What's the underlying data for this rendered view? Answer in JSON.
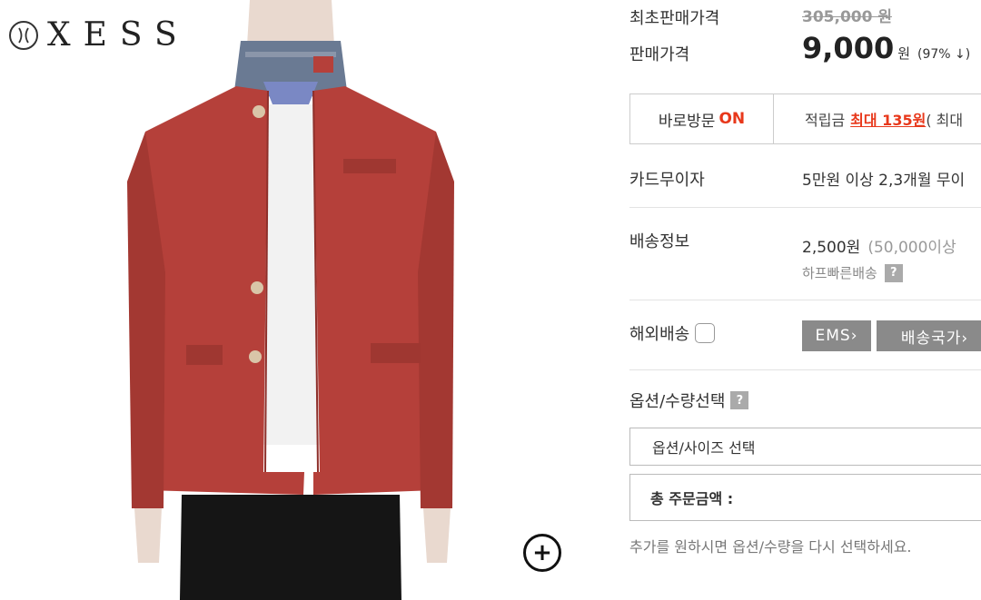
{
  "brand": {
    "name": "XESS",
    "logo": "xess-emblem-icon"
  },
  "zoom": {
    "icon": "zoom-plus-icon"
  },
  "price": {
    "original_label": "최초판매가격",
    "original_value": "305,000 원",
    "sale_label": "판매가격",
    "sale_value": "9,000",
    "sale_unit": "원",
    "discount": "(97% ↓)"
  },
  "visit": {
    "label": "바로방문",
    "status": "ON",
    "points_label": "적립금",
    "points_max": "최대 135원",
    "points_suffix": "( 최대"
  },
  "card": {
    "label": "카드무이자",
    "value": "5만원 이상 2,3개월 무이"
  },
  "shipping": {
    "label": "배송정보",
    "price": "2,500원",
    "note": "(50,000이상",
    "sub": "하프빠른배송",
    "help": "?"
  },
  "overseas": {
    "label": "해외배송",
    "ems_button": "EMS›",
    "country_button": "배송국가›"
  },
  "options": {
    "label": "옵션/수량선택",
    "help": "?",
    "select_placeholder": "옵션/사이즈 선택",
    "total_label": "총 주문금액 :",
    "hint": "추가를 원하시면 옵션/수량을 다시 선택하세요."
  },
  "colors": {
    "accent": "#e8381b",
    "jacket": "#b5403a",
    "button_gray": "#8a8a8a"
  }
}
